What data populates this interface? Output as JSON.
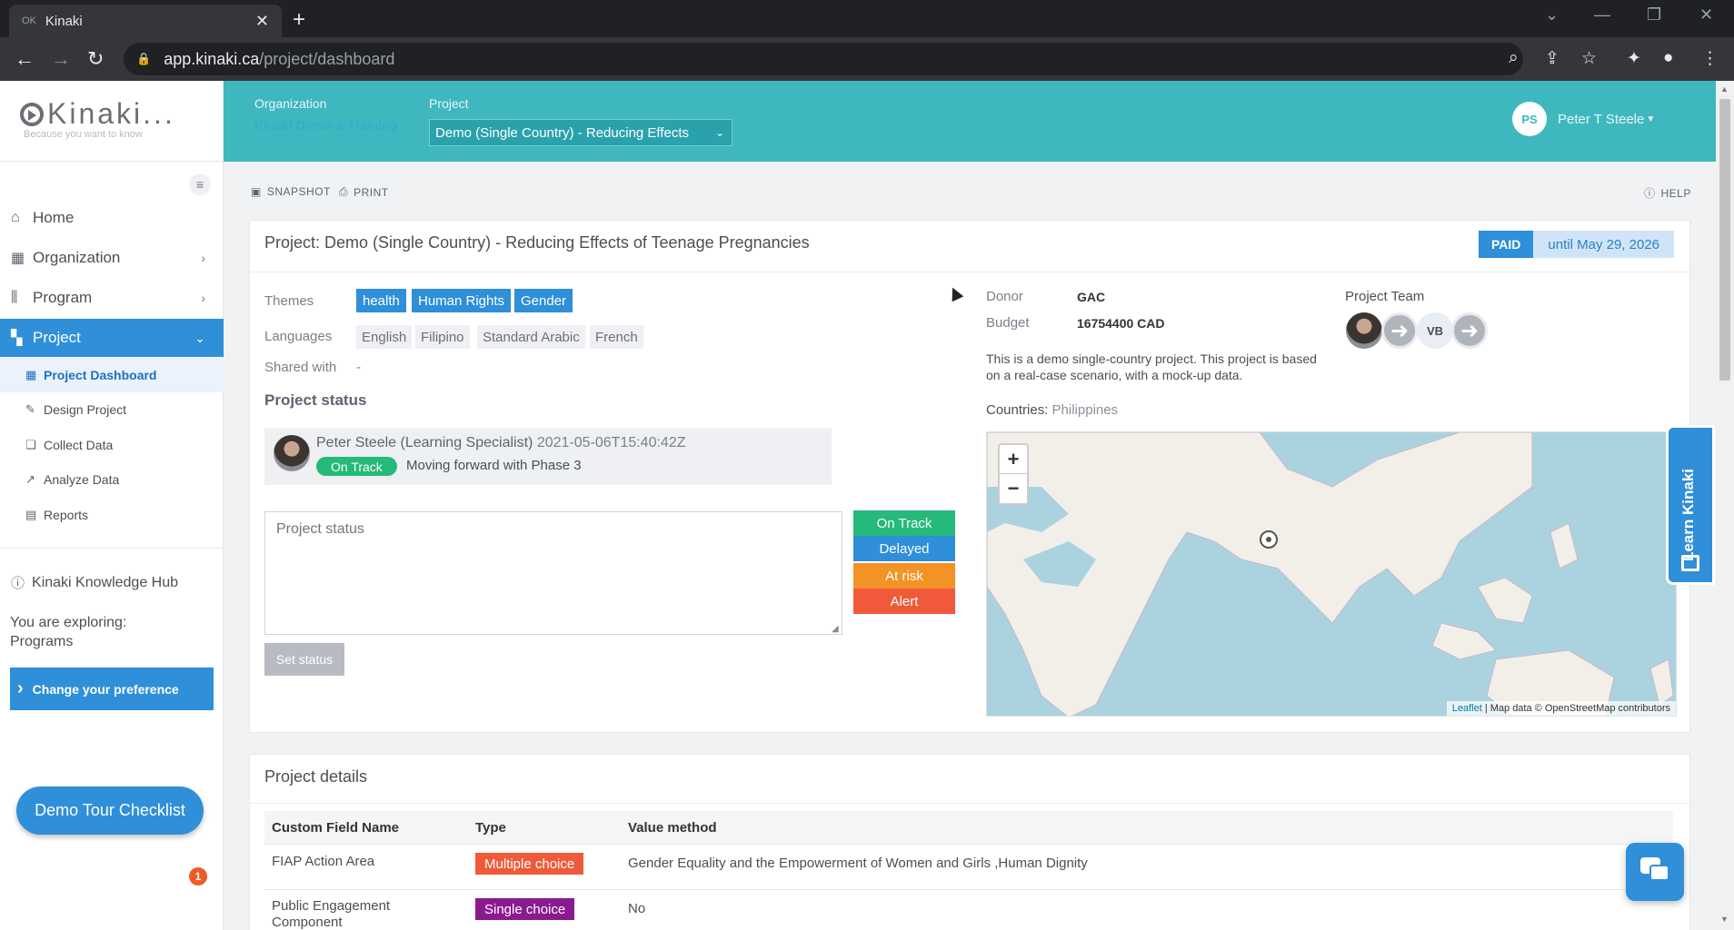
{
  "browser": {
    "tab_title": "Kinaki",
    "tab_favicon": "OK",
    "url_host": "app.kinaki.ca",
    "url_path": "/project/dashboard"
  },
  "sidebar": {
    "logo_text": "Kinaki...",
    "logo_tagline": "Because you want to know",
    "menu": [
      {
        "label": "Home",
        "icon": "home-icon"
      },
      {
        "label": "Organization",
        "icon": "org-icon"
      },
      {
        "label": "Program",
        "icon": "program-icon"
      },
      {
        "label": "Project",
        "icon": "project-icon"
      }
    ],
    "sub_items": [
      {
        "label": "Project Dashboard"
      },
      {
        "label": "Design Project"
      },
      {
        "label": "Collect Data"
      },
      {
        "label": "Analyze Data"
      },
      {
        "label": "Reports"
      }
    ],
    "hub_label": "Kinaki Knowledge Hub",
    "exploring_label": "You are exploring:",
    "exploring_value": "Programs",
    "pref_button": "Change your preference",
    "tour_button": "Demo Tour Checklist",
    "tour_badge": "1"
  },
  "header": {
    "org_label": "Organization",
    "org_name": "Kinaki Demo & Training",
    "project_label": "Project",
    "project_selected": "Demo (Single Country) - Reducing Effects",
    "user_initials": "PS",
    "user_name": "Peter T Steele"
  },
  "toolbar": {
    "snapshot": "SNAPSHOT",
    "print": "PRINT",
    "help": "HELP"
  },
  "project": {
    "title": "Project: Demo (Single Country) - Reducing Effects of Teenage Pregnancies",
    "paid_label": "PAID",
    "paid_until": "until May 29, 2026",
    "themes_label": "Themes",
    "themes": [
      "health",
      "Human Rights",
      "Gender"
    ],
    "languages_label": "Languages",
    "languages": [
      "English",
      "Filipino",
      "Standard Arabic",
      "French"
    ],
    "shared_label": "Shared with",
    "shared_value": "-",
    "status_heading": "Project status",
    "status_entry": {
      "author": "Peter Steele (Learning Specialist)",
      "timestamp": "2021-05-06T15:40:42Z",
      "state": "On Track",
      "message": "Moving forward with Phase 3"
    },
    "status_placeholder": "Project status",
    "status_buttons": [
      {
        "label": "On Track",
        "color": "#25b97a"
      },
      {
        "label": "Delayed",
        "color": "#2f8fd9"
      },
      {
        "label": "At risk",
        "color": "#f39325"
      },
      {
        "label": "Alert",
        "color": "#f05a3a"
      }
    ],
    "set_status": "Set status",
    "donor_label": "Donor",
    "donor": "GAC",
    "budget_label": "Budget",
    "budget": "16754400 CAD",
    "description": "This is a demo single-country project. This project is based on a real-case scenario, with a mock-up data.",
    "countries_label": "Countries:",
    "countries": "Philippines",
    "team_label": "Project Team",
    "team_initials": "VB",
    "map_zoom_in": "+",
    "map_zoom_out": "−",
    "map_attr_link": "Leaflet",
    "map_attr_text": " | Map data © OpenStreetMap contributors"
  },
  "learn": {
    "label": "Learn Kinaki"
  },
  "details": {
    "title": "Project details",
    "columns": [
      "Custom Field Name",
      "Type",
      "Value method"
    ],
    "rows": [
      {
        "name": "FIAP Action Area",
        "type": "Multiple choice",
        "type_color": "#f05a3a",
        "value": "Gender Equality and the Empowerment of Women and Girls ,Human Dignity"
      },
      {
        "name": "Public Engagement Component",
        "type": "Single choice",
        "type_color": "#8b1a8f",
        "value": "No"
      }
    ]
  },
  "colors": {
    "header": "#3fb7bf",
    "accent": "#2f8fd9"
  }
}
